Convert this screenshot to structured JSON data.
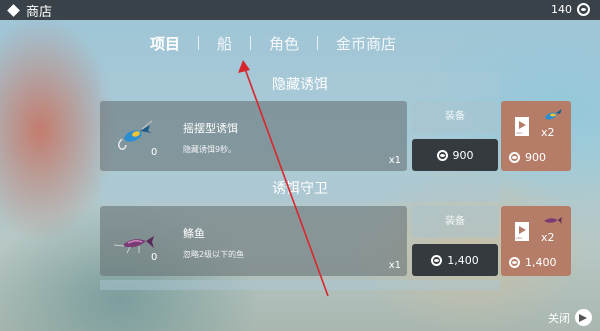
{
  "header": {
    "title": "商店",
    "coins": "140"
  },
  "tabs": [
    {
      "label": "项目"
    },
    {
      "label": "船"
    },
    {
      "label": "角色"
    },
    {
      "label": "金币商店"
    }
  ],
  "sections": [
    {
      "title": "隐藏诱饵",
      "item": {
        "name": "摇摆型诱饵",
        "description": "隐藏诱饵9秒。",
        "owned": "0",
        "quantity": "x1",
        "equip_label": "装备",
        "price": "900",
        "ad_badge": "ADS",
        "ad_quantity": "x2",
        "ad_price": "900"
      }
    },
    {
      "title": "诱饵守卫",
      "item": {
        "name": "鲦鱼",
        "description": "忽略2级以下的鱼",
        "owned": "0",
        "quantity": "x1",
        "equip_label": "装备",
        "price": "1,400",
        "ad_badge": "ADS",
        "ad_quantity": "x2",
        "ad_price": "1,400"
      }
    }
  ],
  "footer": {
    "close_label": "关闭"
  },
  "colors": {
    "topbar": "#2c3034",
    "price_button": "#343a3e",
    "ad_button": "#b57d68",
    "annotation_arrow": "#d9262c"
  }
}
